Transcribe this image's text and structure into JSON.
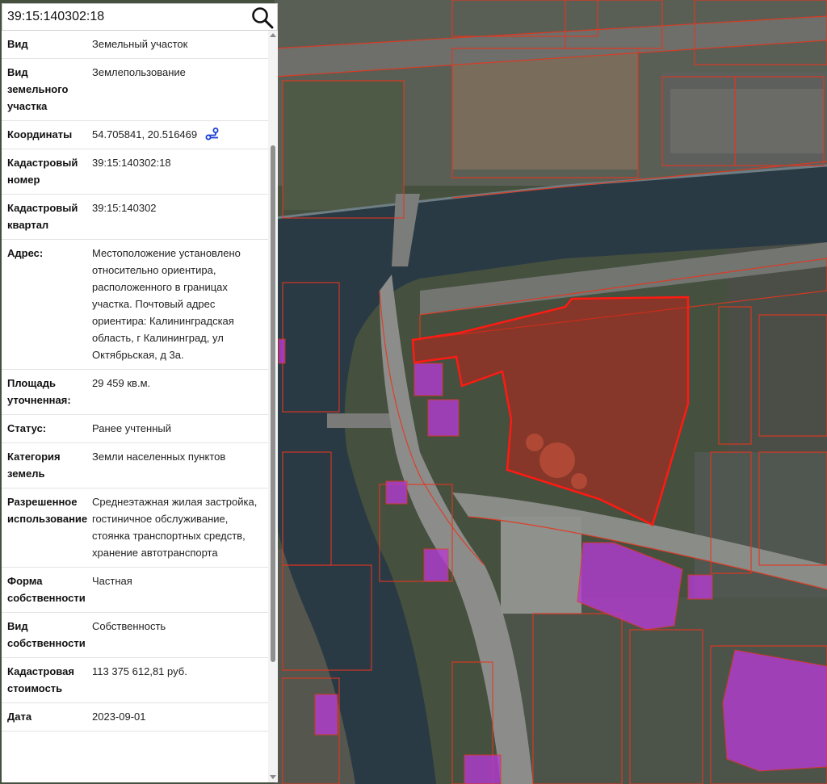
{
  "search": {
    "value": "39:15:140302:18"
  },
  "icons": {
    "search": "search-icon",
    "coords": "route-icon"
  },
  "colors": {
    "parcel_outline": "#e5361e",
    "selected_fill": "#c81e14",
    "building_fill": "#b43cd2",
    "link_icon": "#1a3fd9"
  },
  "info": {
    "rows": [
      {
        "key": "Вид",
        "value": "Земельный участок"
      },
      {
        "key": "Вид земельного участка",
        "value": "Землепользование"
      },
      {
        "key": "Координаты",
        "value": "54.705841, 20.516469",
        "icon": "route-icon"
      },
      {
        "key": "Кадастровый номер",
        "value": "39:15:140302:18"
      },
      {
        "key": "Кадастровый квартал",
        "value": "39:15:140302"
      },
      {
        "key": "Адрес:",
        "value": "Местоположение установлено относительно ориентира, расположенного в границах участка. Почтовый адрес ориентира: Калининградская область, г Калининград, ул Октябрьская, д 3а."
      },
      {
        "key": "Площадь уточненная:",
        "value": "29 459 кв.м."
      },
      {
        "key": "Статус:",
        "value": "Ранее учтенный"
      },
      {
        "key": "Категория земель",
        "value": "Земли населенных пунктов"
      },
      {
        "key": "Разрешенное использование",
        "value": "Среднеэтажная жилая застройка, гостиничное обслуживание, стоянка транспортных средств, хранение автотранспорта"
      },
      {
        "key": "Форма собственности",
        "value": "Частная"
      },
      {
        "key": "Вид собственности",
        "value": "Собственность"
      },
      {
        "key": "Кадастровая стоимость",
        "value": "113 375 612,81 руб."
      },
      {
        "key": "Дата",
        "value": "2023-09-01"
      }
    ]
  }
}
